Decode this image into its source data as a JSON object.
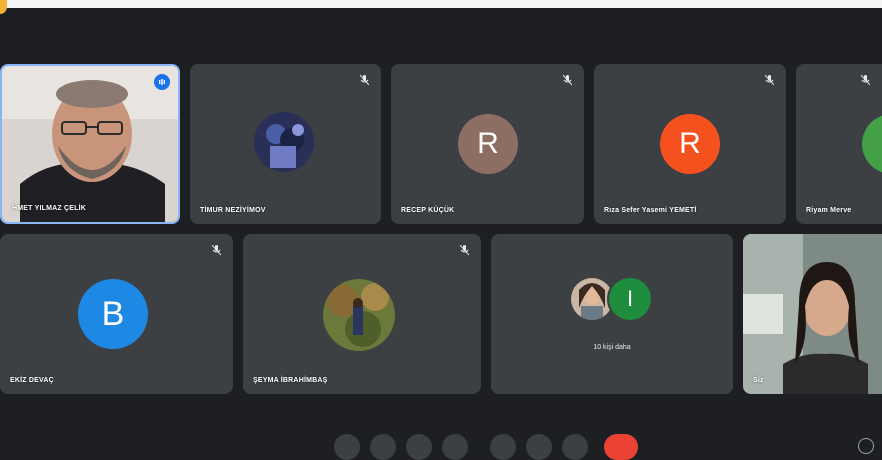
{
  "participants": [
    {
      "name": "HMET YILMAZ ÇELİK",
      "type": "video"
    },
    {
      "name": "TİMUR NEZİYİMOV",
      "type": "photo",
      "muted": true
    },
    {
      "name": "RECEP KÜÇÜK",
      "type": "initial",
      "initial": "R",
      "color": "#8d6e63",
      "muted": true
    },
    {
      "name": "Rıza Sefer Yasemi YEMETİ",
      "type": "initial",
      "initial": "R",
      "color": "#f4511e",
      "muted": true
    },
    {
      "name": "Riyam Merve",
      "type": "initial",
      "initial": "",
      "color": "#43a047",
      "muted": true
    },
    {
      "name": "EKİZ DEVAÇ",
      "type": "initial",
      "initial": "B",
      "color": "#1e88e5",
      "muted": true
    },
    {
      "name": "ŞEYMA İBRAHİMBAŞ",
      "type": "photo",
      "muted": true
    },
    {
      "name": "",
      "type": "group",
      "initial": "I",
      "color": "#1e8e3e",
      "label": "10 kişi daha"
    },
    {
      "name": "Siz",
      "type": "video"
    }
  ],
  "colors": {
    "tile": "#3c4043",
    "background": "#1e1f22",
    "accent": "#1a73e8",
    "end_call": "#ea4335"
  },
  "icons": [
    "mic-off-icon",
    "speaking-icon",
    "end-call-icon"
  ]
}
